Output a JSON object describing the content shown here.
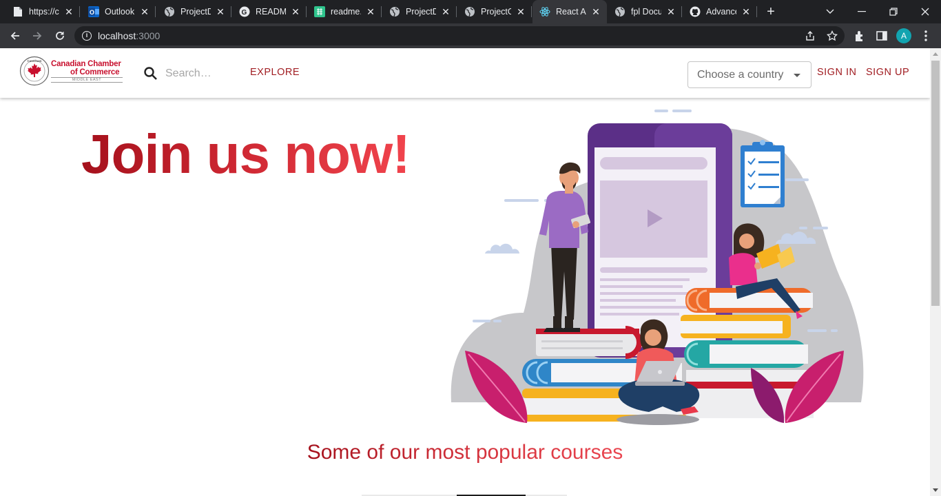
{
  "browser": {
    "tabs": [
      {
        "title": "https://c",
        "icon": "document-icon",
        "active": false
      },
      {
        "title": "Outlook",
        "icon": "outlook-icon",
        "active": false
      },
      {
        "title": "ProjectD",
        "icon": "globe-icon",
        "active": false
      },
      {
        "title": "README",
        "icon": "google-icon",
        "active": false
      },
      {
        "title": "readme.",
        "icon": "markdown-icon",
        "active": false
      },
      {
        "title": "ProjectD",
        "icon": "globe-icon",
        "active": false
      },
      {
        "title": "ProjectG",
        "icon": "globe-icon",
        "active": false
      },
      {
        "title": "React Ap",
        "icon": "react-icon",
        "active": true
      },
      {
        "title": "fpl Docu",
        "icon": "globe-icon",
        "active": false
      },
      {
        "title": "Advance",
        "icon": "github-icon",
        "active": false
      }
    ],
    "url_host": "localhost",
    "url_port": ":3000",
    "profile_initial": "A"
  },
  "header": {
    "logo_line1": "Canadian Chamber",
    "logo_line2": "of Commerce",
    "logo_sub": "MIDDLE EAST",
    "logo_badge_text": "CanCham",
    "search_placeholder": "Search…",
    "explore_label": "EXPLORE",
    "country_placeholder": "Choose a country",
    "signin_label": "SIGN IN",
    "signup_label": "SIGN UP"
  },
  "hero": {
    "title": "Join us now!"
  },
  "courses": {
    "title": "Some of our most popular courses"
  },
  "colors": {
    "brand_red": "#a11d22",
    "accent_red": "#c8102e",
    "chrome_dark": "#202124",
    "chrome_toolbar": "#35363a"
  }
}
